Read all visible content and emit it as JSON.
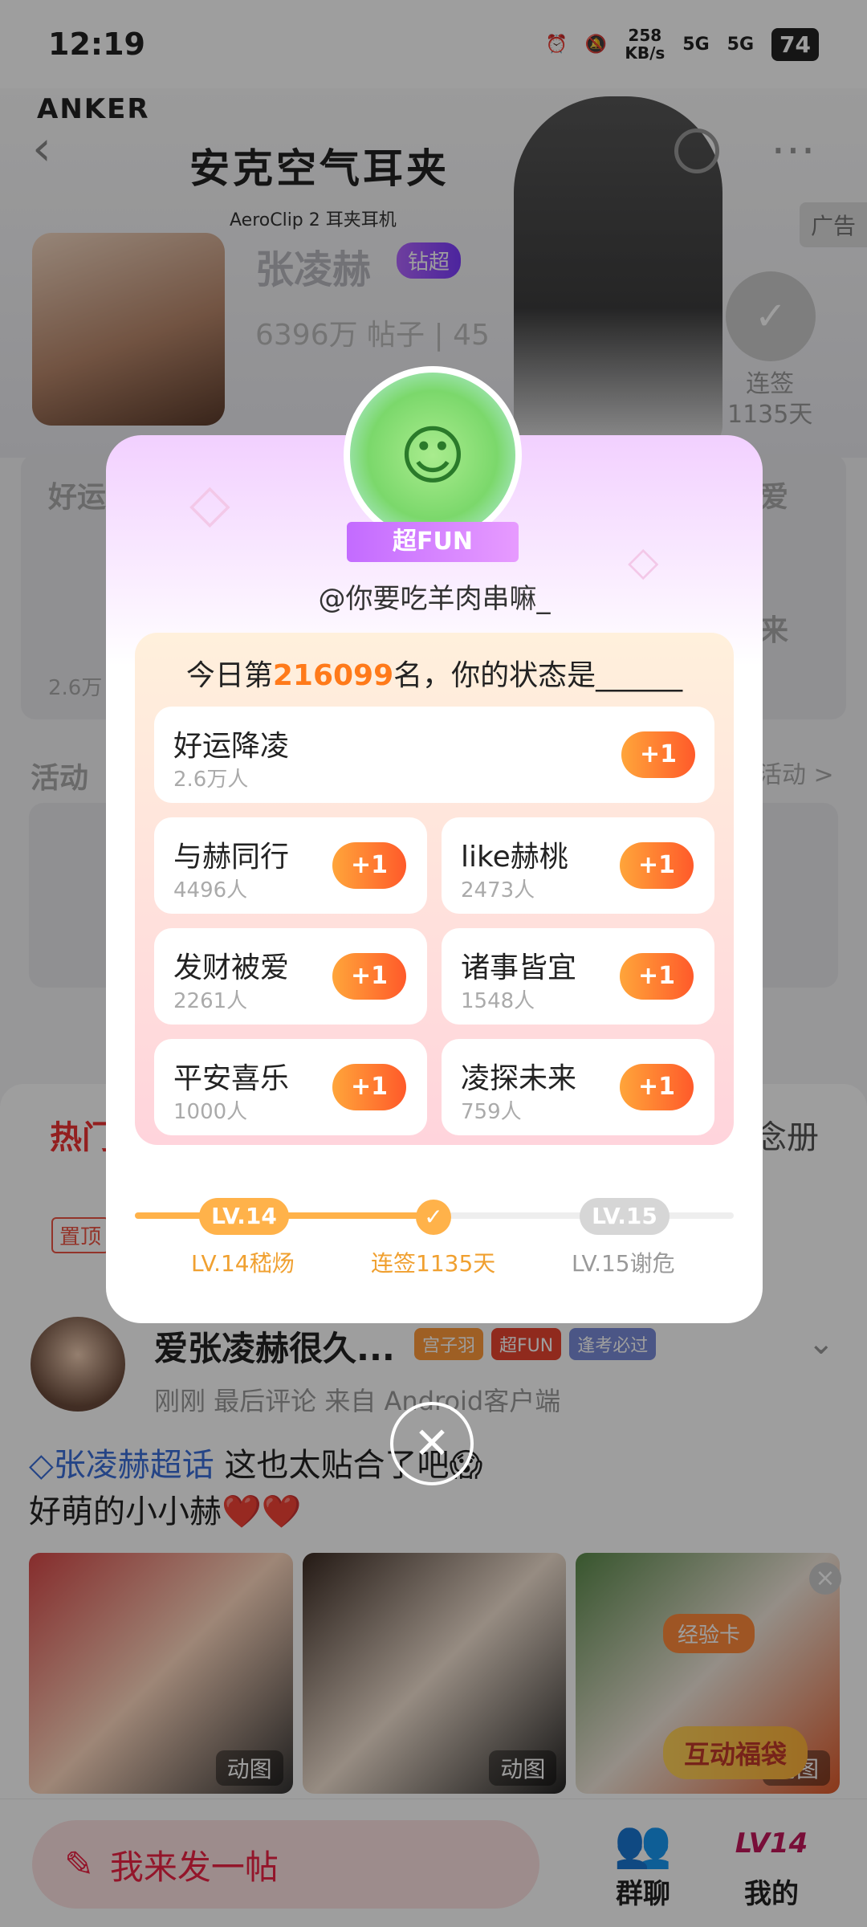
{
  "status_bar": {
    "time": "12:19",
    "speed": "258",
    "speed_unit": "KB/s",
    "net1": "5G",
    "net2": "5G",
    "battery": "74"
  },
  "banner": {
    "brand": "ANKER",
    "title": "安克空气耳夹",
    "subtitle": "AeroClip 2 耳夹耳机",
    "ad_label": "广告"
  },
  "topic": {
    "name": "张凌赫",
    "level": "钻超",
    "stats": "6396万 帖子 | 45",
    "checkin_label": "连签",
    "checkin_days": "1135天"
  },
  "background": {
    "card_left": "好运",
    "card_right1": "爱",
    "card_right2": "来",
    "plus": "+1",
    "activity": "活动",
    "activity_more": "活动 >",
    "ad_label2": "广告",
    "count_small": "2.6万"
  },
  "sheet": {
    "tab_hot": "热门",
    "tab_right": "念册",
    "pin": "置顶"
  },
  "post": {
    "user": "爱张凌赫很久...",
    "badges": [
      "宫子羽",
      "超FUN",
      "逢考必过"
    ],
    "meta": "刚刚  最后评论  来自 Android客户端",
    "tag": "张凌赫超话",
    "text1": " 这也太贴合了吧😱",
    "text2": "好萌的小小赫❤️❤️",
    "img_caption": "动图"
  },
  "promo": {
    "exp_card": "经验卡",
    "fudai": "互动福袋"
  },
  "bottom": {
    "post_btn": "我来发一帖",
    "nav_chat": "群聊",
    "nav_mine": "我的",
    "lv": "LV14"
  },
  "popup": {
    "ribbon": "超FUN",
    "handle": "@你要吃羊肉串嘛_",
    "rank_prefix": "今日第",
    "rank_number": "216099",
    "rank_suffix": "名，你的状态是______",
    "plus_label": "+1",
    "options": [
      {
        "name": "好运降凌",
        "count": "2.6万人"
      },
      {
        "name": "与赫同行",
        "count": "4496人"
      },
      {
        "name": "like赫桃",
        "count": "2473人"
      },
      {
        "name": "发财被爱",
        "count": "2261人"
      },
      {
        "name": "诸事皆宜",
        "count": "1548人"
      },
      {
        "name": "平安喜乐",
        "count": "1000人"
      },
      {
        "name": "凌探未来",
        "count": "759人"
      }
    ],
    "level": {
      "current_pill": "LV.14",
      "next_pill": "LV.15",
      "current_caption": "LV.14嵇炀",
      "middle_caption": "连签1135天",
      "next_caption": "LV.15谢危",
      "progress": 0.51
    },
    "close": "✕"
  },
  "colors": {
    "accent_orange": "#ff7a1a",
    "accent_red": "#e33",
    "ribbon_purple": "#c36bff"
  }
}
